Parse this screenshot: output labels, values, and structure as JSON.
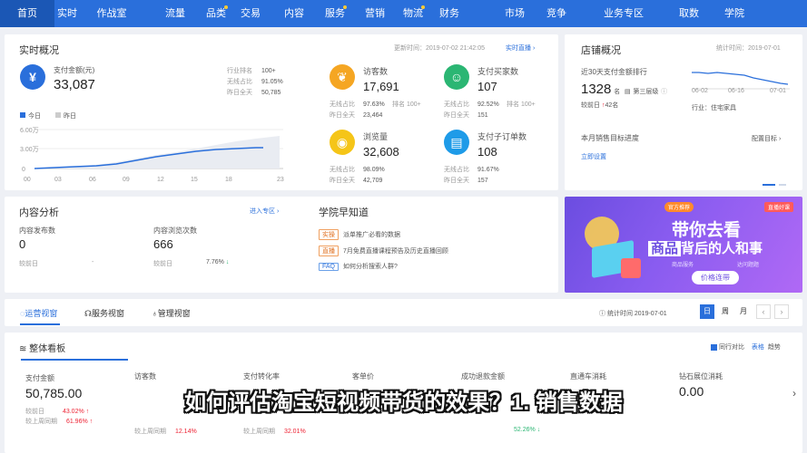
{
  "nav": [
    "首页",
    "实时",
    "作战室",
    "流量",
    "品类",
    "交易",
    "内容",
    "服务",
    "营销",
    "物流",
    "财务",
    "市场",
    "竞争",
    "业务专区",
    "取数",
    "学院"
  ],
  "realtime": {
    "title": "实时概况",
    "update_time": "更新时间：2019-07-02 21:42:05",
    "live_link": "实时直播 ›",
    "pay_label": "支付金额(元)",
    "pay_value": "33,087",
    "industry_rank_label": "行业排名",
    "industry_rank": "100+",
    "wireless_label": "无线占比",
    "wireless": "91.05%",
    "yesterday_label": "昨日全天",
    "yesterday": "50,785",
    "legend_today": "今日",
    "legend_yesterday": "昨日",
    "y_ticks": [
      "6.00万",
      "3.00万",
      "0"
    ],
    "x_ticks": [
      "00",
      "03",
      "06",
      "09",
      "12",
      "15",
      "18",
      "23"
    ]
  },
  "metrics": [
    {
      "name": "访客数",
      "value": "17,691",
      "r1l": "无线占比",
      "r1v": "97.63%",
      "r1x": "排名 100+",
      "r2l": "昨日全天",
      "r2v": "23,464",
      "color": "#f5a623",
      "icon": "paw-icon",
      "glyph": "❦"
    },
    {
      "name": "支付买家数",
      "value": "107",
      "r1l": "无线占比",
      "r1v": "92.52%",
      "r1x": "排名 100+",
      "r2l": "昨日全天",
      "r2v": "151",
      "color": "#2bb673",
      "icon": "user-icon",
      "glyph": "☺"
    },
    {
      "name": "浏览量",
      "value": "32,608",
      "r1l": "无线占比",
      "r1v": "98.09%",
      "r1x": "",
      "r2l": "昨日全天",
      "r2v": "42,709",
      "color": "#f5c518",
      "icon": "eye-icon",
      "glyph": "◉"
    },
    {
      "name": "支付子订单数",
      "value": "108",
      "r1l": "无线占比",
      "r1v": "91.67%",
      "r1x": "",
      "r2l": "昨日全天",
      "r2v": "157",
      "color": "#1e9be8",
      "icon": "order-icon",
      "glyph": "▤"
    }
  ],
  "shop": {
    "title": "店铺概况",
    "stat_time": "统计时间：2019-07-01",
    "rank_label": "近30天支付金额排行",
    "rank_value": "1328",
    "rank_unit": "名",
    "tier": "第三层级",
    "compare_label": "较前日",
    "compare_value": "42名",
    "industry": "行业：住宅家具",
    "x_ticks": [
      "06-02",
      "06-16",
      "07-01"
    ],
    "progress_label": "本月销售目标进度",
    "goal_link": "配置目标 ›",
    "set_link": "立即设置"
  },
  "content": {
    "title": "内容分析",
    "enter_link": "进入专区 ›",
    "publish_label": "内容发布数",
    "publish_value": "0",
    "publish_cmp": "较前日",
    "publish_delta": "-",
    "browse_label": "内容浏览次数",
    "browse_value": "666",
    "browse_cmp": "较前日",
    "browse_delta": "7.76%"
  },
  "academy": {
    "title": "学院早知道",
    "items": [
      {
        "tag": "实操",
        "text": "派单推广必看的数据"
      },
      {
        "tag": "直播",
        "text": "7月免费直播课程预告及历史直播回顾"
      },
      {
        "tag": "FAQ",
        "text": "如何分析搜索人群?"
      }
    ]
  },
  "banner": {
    "badge": "官方推荐",
    "right_tag": "直播好课",
    "title1": "带你去看",
    "title2a": "商品",
    "title2b": "背后的人和事",
    "sub": "商品服务",
    "sub2": "达问题题",
    "btn": "价格连带"
  },
  "tabs": {
    "items": [
      "运营视窗",
      "服务视窗",
      "管理视窗"
    ],
    "stat_time": "统计时间 2019-07-01",
    "ranges": [
      "日",
      "周",
      "月"
    ]
  },
  "board": {
    "title": "整体看板",
    "compare_label": "同行对比",
    "view_table": "表格",
    "view_trend": "趋势"
  },
  "kpis": [
    {
      "name": "支付金额",
      "value": "50,785.00",
      "r1l": "较前日",
      "r1v": "43.02%",
      "r2l": "较上周同期",
      "r2v": "61.96%"
    },
    {
      "name": "访客数",
      "value": "",
      "r1l": "",
      "r1v": "",
      "r2l": "较上周同期",
      "r2v": "12.14%"
    },
    {
      "name": "支付转化率",
      "value": "",
      "r1l": "",
      "r1v": "",
      "r2l": "较上周同期",
      "r2v": "32.01%"
    },
    {
      "name": "客单价",
      "value": "",
      "r1l": "",
      "r1v": "",
      "r2l": "",
      "r2v": ""
    },
    {
      "name": "成功退款金额",
      "value": "",
      "r1l": "",
      "r1v": "",
      "r2l": "",
      "r2v": "52.26%"
    },
    {
      "name": "直通车消耗",
      "value": "",
      "r1l": "",
      "r1v": "",
      "r2l": "",
      "r2v": ""
    },
    {
      "name": "钻石展位消耗",
      "value": "0.00",
      "r1l": "",
      "r1v": "",
      "r2l": "",
      "r2v": ""
    }
  ],
  "subtitle": "如何评估淘宝短视频带货的效果？1. 销售数据"
}
